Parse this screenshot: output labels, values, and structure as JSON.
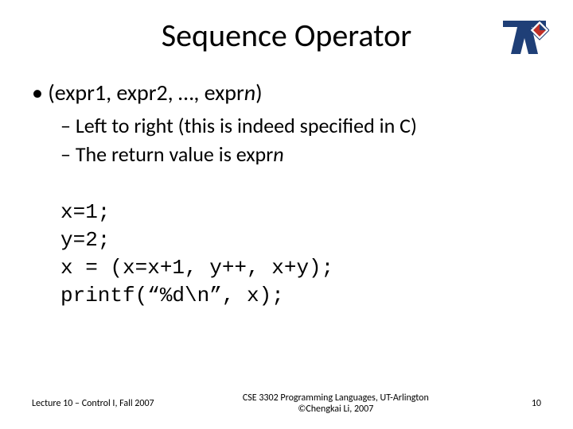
{
  "title": "Sequence Operator",
  "bullet": {
    "pre": "(expr1, expr2, …, expr",
    "n": "n",
    "post": ")"
  },
  "sub1": "Left to right (this is indeed specified in C)",
  "sub2_pre": "The return value is expr",
  "sub2_n": "n",
  "code": {
    "l1": "x=1;",
    "l2": "y=2;",
    "l3": "x = (x=x+1, y++, x+y);",
    "l4": "printf(“%d\\n”, x);"
  },
  "footer": {
    "left": "Lecture 10 – Control I, Fall 2007",
    "center1": "CSE 3302 Programming Languages, UT-Arlington",
    "center2": "©Chengkai Li, 2007",
    "page": "10"
  },
  "logo_name": "uta-logo"
}
